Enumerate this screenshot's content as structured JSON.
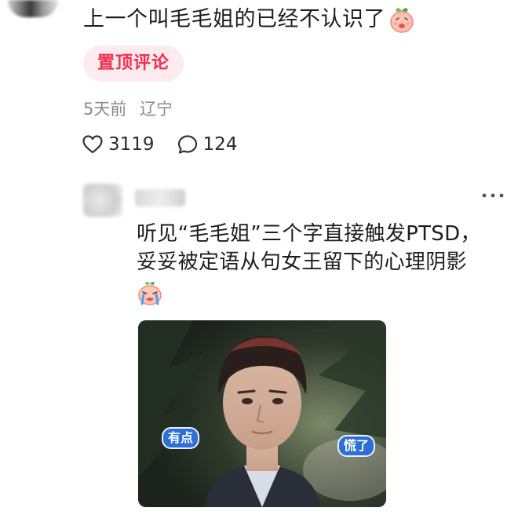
{
  "comment": {
    "text": "上一个叫毛毛姐的已经不认识了",
    "pinned_badge": "置顶评论",
    "time": "5天前",
    "location": "辽宁",
    "likes": "3119",
    "replies": "124"
  },
  "reply": {
    "line1": "听见“毛毛姐”三个字直接触发PTSD，",
    "line2": "妥妥被定语从句女王留下的心理阴影",
    "image": {
      "label_left": "有点",
      "label_right": "慌了"
    }
  },
  "icons": {
    "like": "heart-outline-icon",
    "reply": "comment-bubble-icon",
    "more": "more-dots-icon",
    "emoji1": "peach-emoji-icon",
    "emoji2": "crying-emoji-icon"
  },
  "colors": {
    "accent": "#f0304f",
    "badge_bg": "#fdebee",
    "meta_text": "#8a8a8a"
  }
}
